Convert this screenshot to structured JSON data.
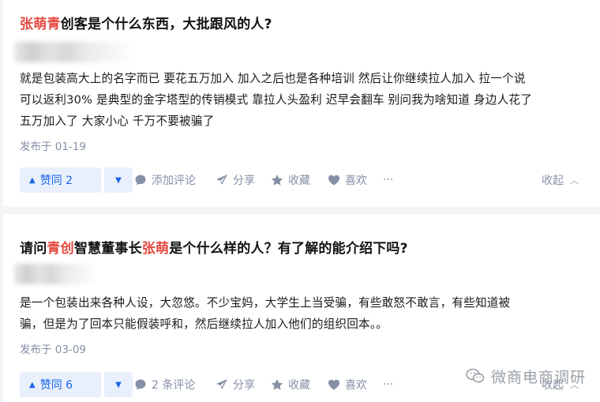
{
  "answers": [
    {
      "title_parts": [
        {
          "text": "张萌青",
          "highlight": true
        },
        {
          "text": "创客是个什么东西，大批跟风的人?",
          "highlight": false
        }
      ],
      "content_lines": [
        "就是包装高大上的名字而已 要花五万加入 加入之后也是各种培训 然后让你继续拉人加入 拉一个说",
        "可以返利30% 是典型的金字塔型的传销模式 靠拉人头盈利 迟早会翻车 别问我为啥知道 身边人花了",
        "五万加入了 大家小心 千万不要被骗了"
      ],
      "meta": "发布于 01-19",
      "vote_label": "赞同 2",
      "comment_label": "添加评论",
      "share_label": "分享",
      "favorite_label": "收藏",
      "like_label": "喜欢",
      "more_label": "···",
      "collapse_label": "收起"
    },
    {
      "title_parts": [
        {
          "text": "请问",
          "highlight": false
        },
        {
          "text": "青创",
          "highlight": true
        },
        {
          "text": "智慧董事长",
          "highlight": false
        },
        {
          "text": "张萌",
          "highlight": true
        },
        {
          "text": "是个什么样的人？有了解的能介绍下吗?",
          "highlight": false
        }
      ],
      "content_lines": [
        "是一个包装出来各种人设，大忽悠。不少宝妈，大学生上当受骗，有些敢怒不敢言，有些知道被",
        "骗，但是为了回本只能假装呼和，然后继续拉人加入他们的组织回本。。"
      ],
      "meta": "发布于 03-09",
      "vote_label": "赞同 6",
      "comment_label": "2 条评论",
      "share_label": "分享",
      "favorite_label": "收藏",
      "like_label": "喜欢",
      "more_label": "···",
      "collapse_label": "收起"
    }
  ],
  "watermark": {
    "text": "微商电商调研",
    "icon": "wechat-icon"
  },
  "colors": {
    "highlight": "#e5483f",
    "vote_bg": "#e9f0fc",
    "vote_text": "#1966e6",
    "meta": "#8590a6",
    "page_bg": "#f3f4f6"
  }
}
